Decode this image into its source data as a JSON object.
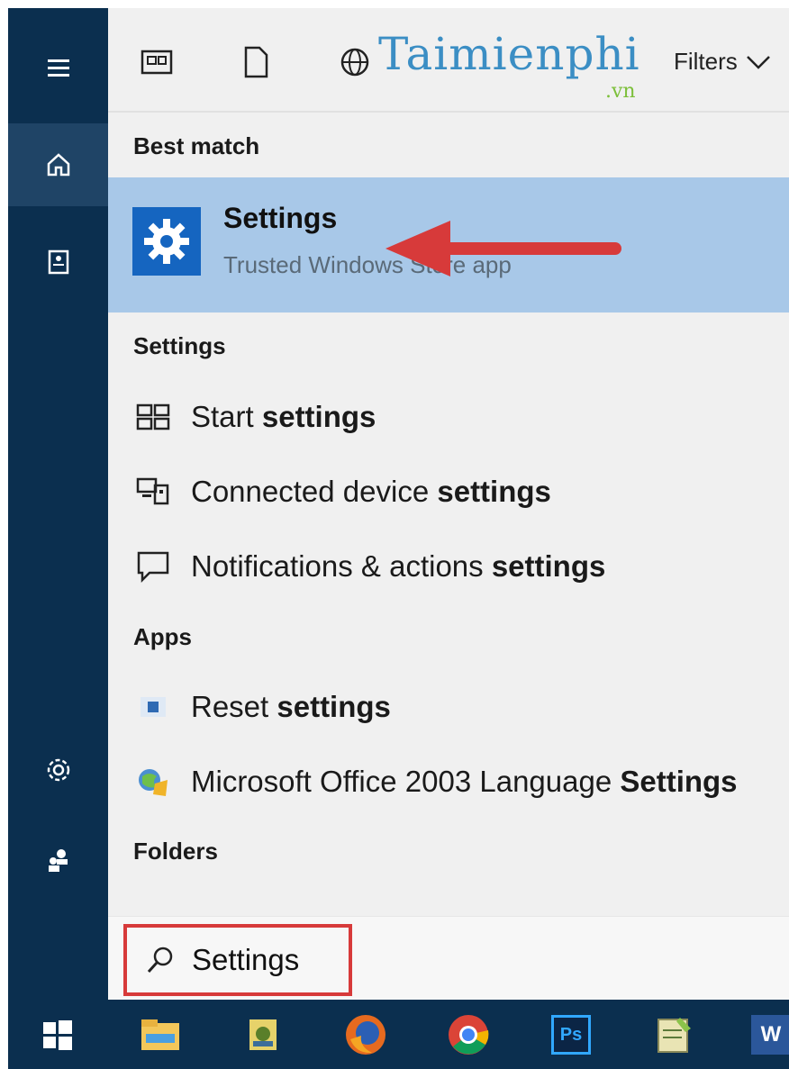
{
  "colors": {
    "rail": "#0b2f4f",
    "rail_active": "#1f4466",
    "highlight": "#a8c8e8",
    "accent_blue": "#1565c0",
    "annotation_red": "#d73a3a"
  },
  "rail": {
    "items": [
      {
        "name": "menu",
        "icon": "hamburger-icon"
      },
      {
        "name": "home",
        "icon": "home-icon",
        "active": true
      },
      {
        "name": "notebook",
        "icon": "notebook-icon"
      },
      {
        "name": "settings",
        "icon": "gear-icon"
      },
      {
        "name": "feedback",
        "icon": "feedback-icon"
      }
    ]
  },
  "topbar": {
    "icons": [
      "apps-filter-icon",
      "documents-filter-icon",
      "web-filter-icon"
    ],
    "watermark": "Taimienphi",
    "watermark_sub": ".vn",
    "filters_label": "Filters"
  },
  "best_match": {
    "header": "Best match",
    "title": "Settings",
    "subtitle": "Trusted Windows Store app",
    "icon": "gear-icon"
  },
  "settings_section": {
    "header": "Settings",
    "items": [
      {
        "prefix": "Start ",
        "bold": "settings",
        "icon": "start-layout-icon"
      },
      {
        "prefix": "Connected device ",
        "bold": "settings",
        "icon": "devices-icon"
      },
      {
        "prefix": "Notifications & actions ",
        "bold": "settings",
        "icon": "notification-icon"
      }
    ]
  },
  "apps_section": {
    "header": "Apps",
    "items": [
      {
        "prefix": "Reset ",
        "bold": "settings",
        "icon": "reset-app-icon"
      },
      {
        "prefix": "Microsoft Office 2003 Language ",
        "bold": "Settings",
        "icon": "office-language-icon"
      }
    ]
  },
  "folders_section": {
    "header": "Folders"
  },
  "search": {
    "value": "Settings",
    "icon": "search-icon"
  },
  "taskbar": {
    "apps": [
      "windows-start-icon",
      "file-explorer-icon",
      "app-icon",
      "firefox-icon",
      "chrome-icon",
      "photoshop-icon",
      "notepad-icon",
      "word-icon"
    ],
    "photoshop_label": "Ps",
    "word_label": "W"
  }
}
